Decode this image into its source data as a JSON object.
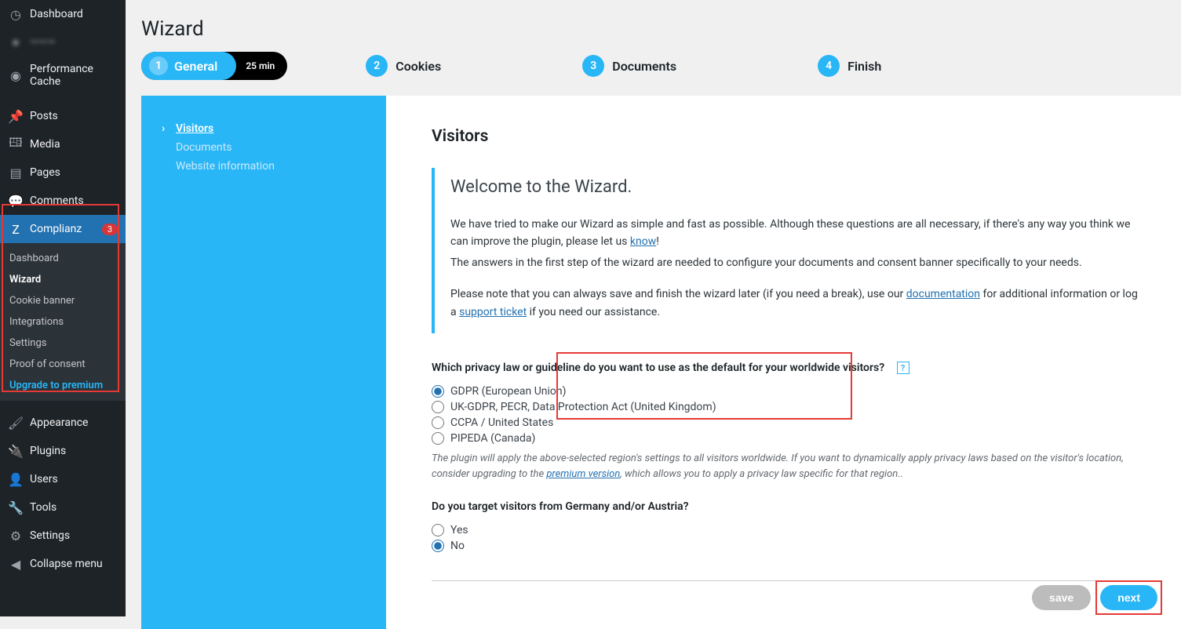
{
  "sidebar": {
    "items": [
      {
        "icon": "◷",
        "label": "Dashboard"
      },
      {
        "icon": "●",
        "label": "———"
      },
      {
        "icon": "◉",
        "label": "Performance Cache"
      },
      {
        "icon": "📌",
        "label": "Posts"
      },
      {
        "icon": "🖽",
        "label": "Media"
      },
      {
        "icon": "▤",
        "label": "Pages"
      },
      {
        "icon": "💬",
        "label": "Comments"
      },
      {
        "icon": "Z",
        "label": "Complianz",
        "badge": "3"
      },
      {
        "icon": "🖌",
        "label": "Appearance"
      },
      {
        "icon": "🔌",
        "label": "Plugins"
      },
      {
        "icon": "👤",
        "label": "Users"
      },
      {
        "icon": "🔧",
        "label": "Tools"
      },
      {
        "icon": "⚙",
        "label": "Settings"
      },
      {
        "icon": "◀",
        "label": "Collapse menu"
      }
    ],
    "submenu": [
      "Dashboard",
      "Wizard",
      "Cookie banner",
      "Integrations",
      "Settings",
      "Proof of consent",
      "Upgrade to premium"
    ]
  },
  "wizard": {
    "title": "Wizard",
    "step1": {
      "num": "1",
      "label": "General",
      "time": "25 min"
    },
    "steps": [
      {
        "num": "2",
        "label": "Cookies"
      },
      {
        "num": "3",
        "label": "Documents"
      },
      {
        "num": "4",
        "label": "Finish"
      }
    ]
  },
  "leftPanel": {
    "items": [
      "Visitors",
      "Documents",
      "Website information"
    ]
  },
  "content": {
    "sectionTitle": "Visitors",
    "welcomeHeading": "Welcome to the Wizard.",
    "p1a": "We have tried to make our Wizard as simple and fast as possible. Although these questions are all necessary, if there's any way you think we can improve the plugin, please let us ",
    "know": "know",
    "p1b": "!",
    "p2": "The answers in the first step of the wizard are needed to configure your documents and consent banner specifically to your needs.",
    "p3a": "Please note that you can always save and finish the wizard later (if you need a break), use our ",
    "doc": "documentation",
    "p3b": " for additional information or log a ",
    "ticket": "support ticket",
    "p3c": " if you need our assistance.",
    "q1": "Which privacy law or guideline do you want to use as the default for your worldwide visitors?",
    "q1_help": "?",
    "q1_options": [
      "GDPR (European Union)",
      "UK-GDPR, PECR, Data Protection Act (United Kingdom)",
      "CCPA / United States",
      "PIPEDA (Canada)"
    ],
    "note_a": "The plugin will apply the above-selected region's settings to all visitors worldwide. If you want to dynamically apply privacy laws based on the visitor's location, consider upgrading to the ",
    "premium": "premium version",
    "note_b": ", which allows you to apply a privacy law specific for that region..",
    "q2": "Do you target visitors from Germany and/or Austria?",
    "q2_yes": "Yes",
    "q2_no": "No",
    "save": "save",
    "next": "next"
  }
}
